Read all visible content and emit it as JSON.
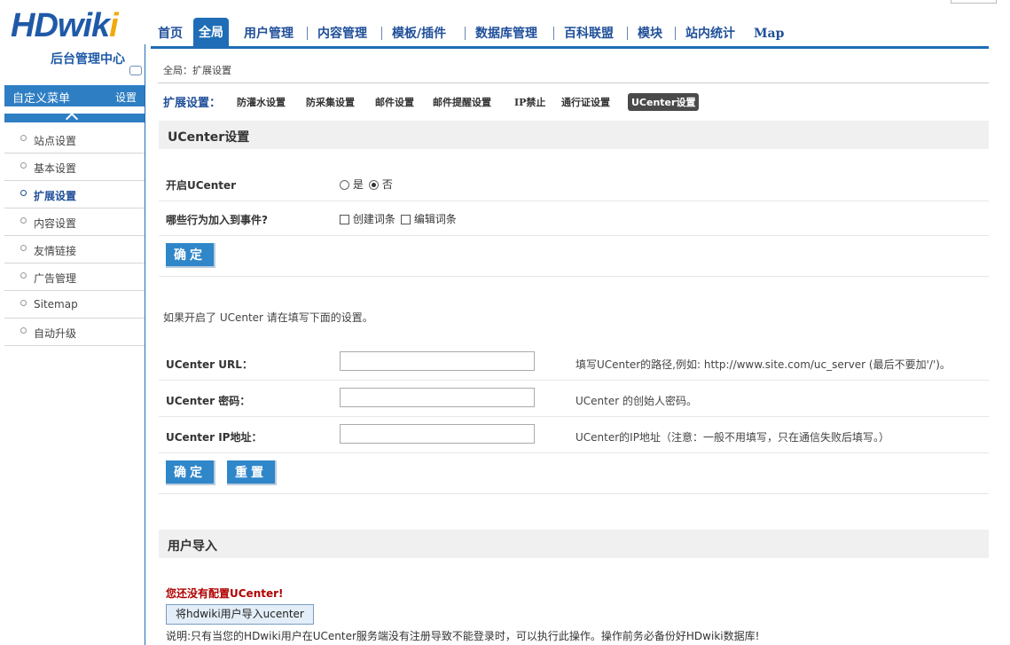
{
  "logo": {
    "wordmark": "HDwik",
    "wordmark_dot": "i",
    "subtitle": "后台管理中心"
  },
  "topnav": {
    "items": [
      {
        "label": "首页"
      },
      {
        "label": "全局"
      },
      {
        "label": "用户管理"
      },
      {
        "label": "内容管理"
      },
      {
        "label": "模板/插件"
      },
      {
        "label": "数据库管理"
      },
      {
        "label": "百科联盟"
      },
      {
        "label": "模块"
      },
      {
        "label": "站内统计"
      },
      {
        "label": "Map"
      }
    ],
    "active_index": 1
  },
  "sidebar": {
    "title": "自定义菜单",
    "settings": "设置",
    "items": [
      {
        "label": "站点设置"
      },
      {
        "label": "基本设置"
      },
      {
        "label": "扩展设置"
      },
      {
        "label": "内容设置"
      },
      {
        "label": "友情链接"
      },
      {
        "label": "广告管理"
      },
      {
        "label": "Sitemap"
      },
      {
        "label": "自动升级"
      }
    ],
    "active_index": 2
  },
  "breadcrumb": "全局：扩展设置",
  "subtabs": {
    "label": "扩展设置：",
    "items": [
      {
        "label": "防灌水设置"
      },
      {
        "label": "防采集设置"
      },
      {
        "label": "邮件设置"
      },
      {
        "label": "邮件提醒设置"
      },
      {
        "label": "IP禁止"
      },
      {
        "label": "通行证设置"
      },
      {
        "label": "UCenter设置"
      }
    ],
    "active_index": 6
  },
  "section1": {
    "title": "UCenter设置",
    "enable_label": "开启UCenter",
    "enable_yes": "是",
    "enable_no": "否",
    "enable_value": "否",
    "events_label": "哪些行为加入到事件?",
    "event_create": "创建词条",
    "event_edit": "编辑词条",
    "confirm": "确定"
  },
  "note": "如果开启了 UCenter 请在填写下面的设置。",
  "section2": {
    "url_label": "UCenter URL：",
    "url_value": "",
    "url_hint": "填写UCenter的路径,例如: http://www.site.com/uc_server (最后不要加'/')。",
    "pwd_label": "UCenter 密码：",
    "pwd_value": "",
    "pwd_hint": "UCenter 的创始人密码。",
    "ip_label": "UCenter IP地址：",
    "ip_value": "",
    "ip_hint": "UCenter的IP地址（注意：一般不用填写，只在通信失败后填写。）",
    "confirm": "确定",
    "reset": "重置"
  },
  "section3": {
    "title": "用户导入",
    "warning": "您还没有配置UCenter!",
    "import_button": "将hdwiki用户导入ucenter",
    "desc": "说明:只有当您的HDwiki用户在UCenter服务端没有注册导致不能登录时，可以执行此操作。操作前务必备份好HDwiki数据库!"
  }
}
